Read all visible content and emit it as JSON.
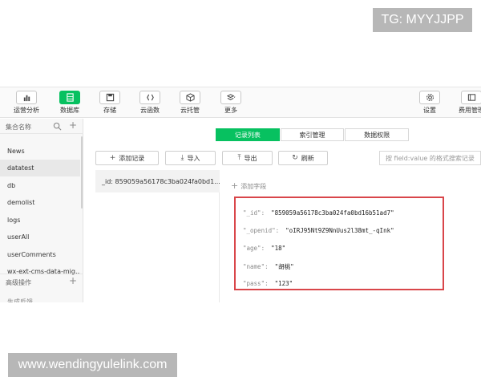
{
  "watermark_top": "TG: MYYJJPP",
  "watermark_bottom": "www.wendingyulelink.com",
  "toolbar": {
    "analytics": "运营分析",
    "database": "数据库",
    "storage": "存储",
    "cloud_functions": "云函数",
    "cloud_hosting": "云托管",
    "more": "更多",
    "settings": "设置",
    "billing": "费用管理"
  },
  "sidebar": {
    "header": "集合名称",
    "items": [
      "News",
      "datatest",
      "db",
      "demolist",
      "logs",
      "userAll",
      "userComments",
      "wx-ext-cms-data-mig..."
    ],
    "advanced": "高级操作",
    "cut_item": "生成反馈"
  },
  "tabs": [
    "记录列表",
    "索引管理",
    "数据权限"
  ],
  "actions": {
    "add_record": "添加记录",
    "import": "导入",
    "export": "导出",
    "refresh": "刷新"
  },
  "filter_placeholder": "按 field:value 的格式搜索记录",
  "doc_list": [
    "_id: 859059a56178c3ba024fa0bd1..."
  ],
  "add_field": "添加字段",
  "record_fields": [
    {
      "key": "\"_id\":",
      "value": "\"859059a56178c3ba024fa0bd16b51ad7\""
    },
    {
      "key": "\"_openid\":",
      "value": "\"oIRJ95Nt9Z9NnUus2l38mt_-qInk\""
    },
    {
      "key": "\"age\":",
      "value": "\"18\""
    },
    {
      "key": "\"name\":",
      "value": "\"胡桃\""
    },
    {
      "key": "\"pass\":",
      "value": "\"123\""
    }
  ],
  "colors": {
    "accent": "#07c160",
    "highlight_border": "#d9464a"
  }
}
